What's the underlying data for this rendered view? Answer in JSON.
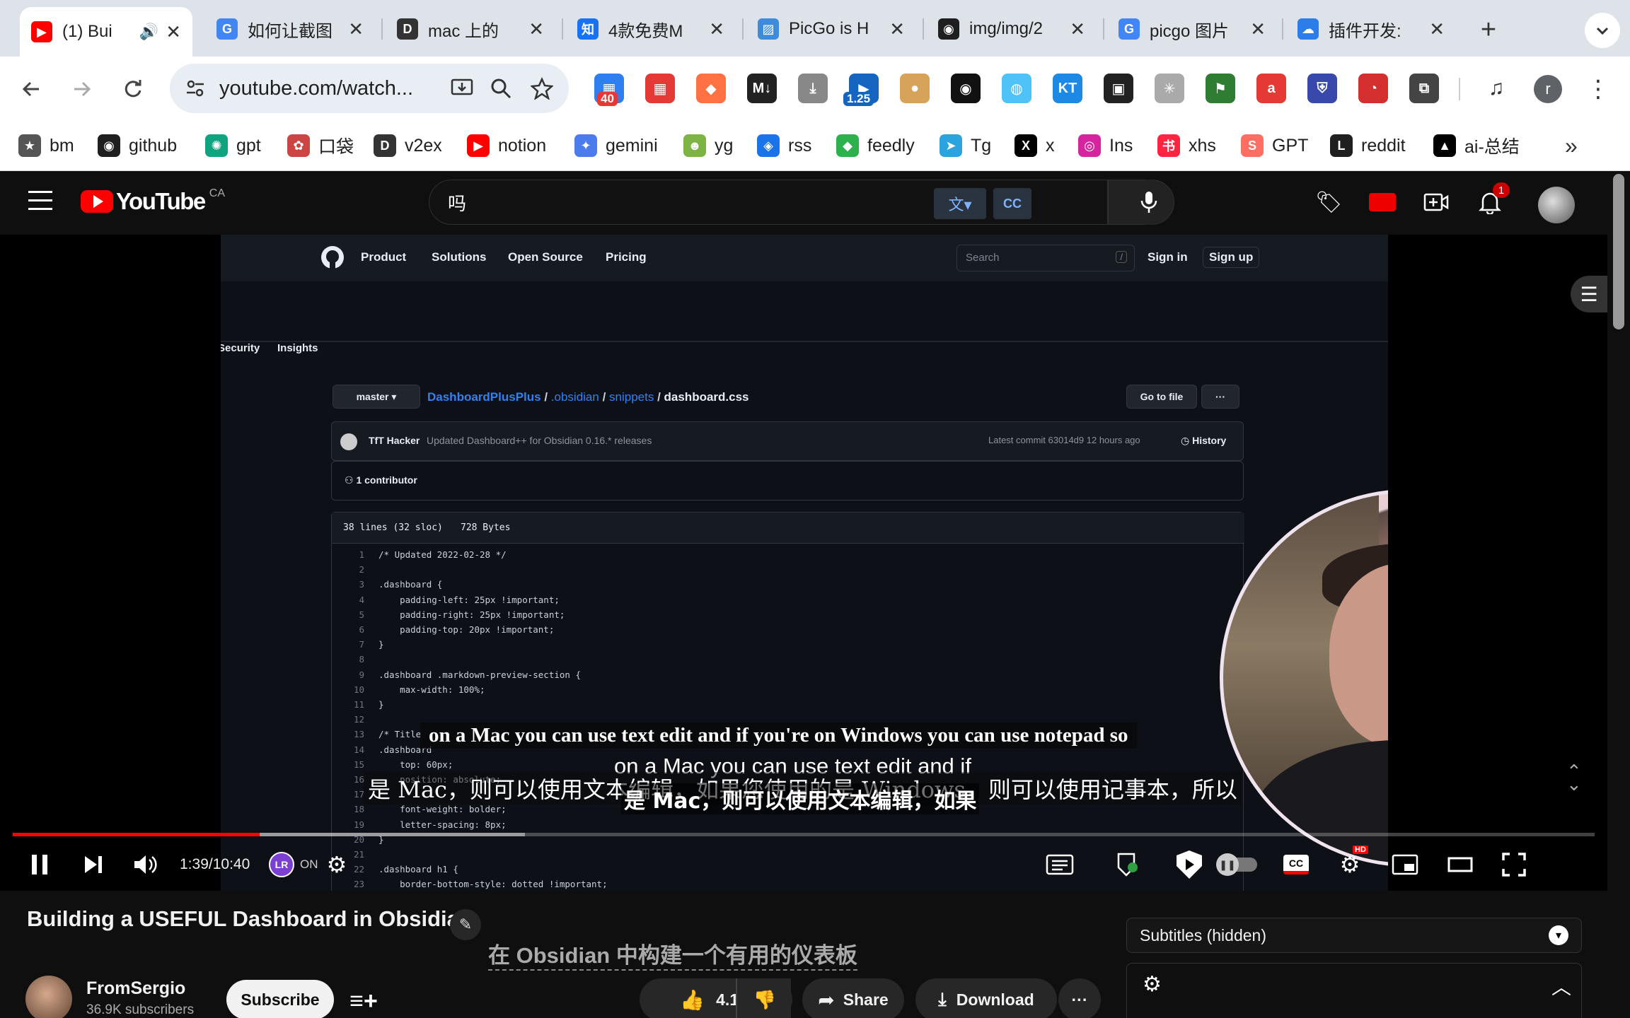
{
  "tabs": [
    {
      "title": "(1) Bui",
      "icon": "youtube",
      "color": "#ff0000",
      "glyph": "▶",
      "active": true
    },
    {
      "title": "如何让截图",
      "icon": "google",
      "color": "#4285f4",
      "glyph": "G"
    },
    {
      "title": "mac 上的",
      "icon": "v2ex",
      "color": "#333333",
      "glyph": "D"
    },
    {
      "title": "4款免费M",
      "icon": "zhihu",
      "color": "#1772f6",
      "glyph": "知"
    },
    {
      "title": "PicGo is H",
      "icon": "picgo",
      "color": "#3d8bd9",
      "glyph": "▨"
    },
    {
      "title": "img/img/2",
      "icon": "github",
      "color": "#1f1f1f",
      "glyph": "◉"
    },
    {
      "title": "picgo 图片",
      "icon": "google",
      "color": "#4285f4",
      "glyph": "G"
    },
    {
      "title": "插件开发:",
      "icon": "cloud",
      "color": "#2b7de9",
      "glyph": "☁"
    }
  ],
  "omnibox": {
    "url": "youtube.com/watch..."
  },
  "extension_badges": {
    "badge1": "40",
    "badge2": "1.25"
  },
  "bookmarks": [
    {
      "label": "bm",
      "glyph": "★",
      "color": "#555555"
    },
    {
      "label": "github",
      "glyph": "◉",
      "color": "#1f1f1f"
    },
    {
      "label": "gpt",
      "glyph": "✺",
      "color": "#10a37f"
    },
    {
      "label": "口袋",
      "glyph": "✿",
      "color": "#c44"
    },
    {
      "label": "v2ex",
      "glyph": "D",
      "color": "#333333"
    },
    {
      "label": "notion",
      "glyph": "▶",
      "color": "#ff0000"
    },
    {
      "label": "gemini",
      "glyph": "✦",
      "color": "#4b7bec"
    },
    {
      "label": "yg",
      "glyph": "☻",
      "color": "#7cb342"
    },
    {
      "label": "rss",
      "glyph": "◈",
      "color": "#1a73e8"
    },
    {
      "label": "feedly",
      "glyph": "◆",
      "color": "#2bb24c"
    },
    {
      "label": "Tg",
      "glyph": "➤",
      "color": "#2aa3df"
    },
    {
      "label": "x",
      "glyph": "X",
      "color": "#000000"
    },
    {
      "label": "Ins",
      "glyph": "◎",
      "color": "#d6249f"
    },
    {
      "label": "xhs",
      "glyph": "书",
      "color": "#ff2442"
    },
    {
      "label": "GPT",
      "glyph": "S",
      "color": "#ff6f61"
    },
    {
      "label": "reddit",
      "glyph": "L",
      "color": "#1f1f1f"
    },
    {
      "label": "ai-总结",
      "glyph": "▲",
      "color": "#000000"
    }
  ],
  "youtube": {
    "logo_text": "YouTube",
    "country": "CA",
    "search_value": "吗",
    "notification_count": "1"
  },
  "github_page": {
    "nav": [
      "Product",
      "Solutions",
      "Open Source",
      "Pricing"
    ],
    "search_placeholder": "Search",
    "search_key": "/",
    "sign_in": "Sign in",
    "sign_up": "Sign up",
    "tabs": [
      "Security",
      "Insights"
    ],
    "branch": "master",
    "path": {
      "repo": "DashboardPlusPlus",
      "sep1": " / ",
      "dir1": ".obsidian",
      "sep2": " / ",
      "dir2": "snippets",
      "sep3": " / ",
      "file": "dashboard.css"
    },
    "go_to_file": "Go to file",
    "more": "···",
    "commit_author": "TfT Hacker",
    "commit_message": "Updated Dashboard++ for Obsidian 0.16.* releases",
    "commit_meta": "Latest commit 63014d9 12 hours ago",
    "history": "History",
    "contributors": "1 contributor",
    "file_lines": "38 lines (32 sloc)",
    "file_size": "728 Bytes",
    "code": [
      {
        "n": "1",
        "t": "/* Updated 2022-02-28 */"
      },
      {
        "n": "2",
        "t": ""
      },
      {
        "n": "3",
        "t": ".dashboard {"
      },
      {
        "n": "4",
        "t": "    padding-left: 25px !important;"
      },
      {
        "n": "5",
        "t": "    padding-right: 25px !important;"
      },
      {
        "n": "6",
        "t": "    padding-top: 20px !important;"
      },
      {
        "n": "7",
        "t": "}"
      },
      {
        "n": "8",
        "t": ""
      },
      {
        "n": "9",
        "t": ".dashboard .markdown-preview-section {"
      },
      {
        "n": "10",
        "t": "    max-width: 100%;"
      },
      {
        "n": "11",
        "t": "}"
      },
      {
        "n": "12",
        "t": ""
      },
      {
        "n": "13",
        "t": "/* Title"
      },
      {
        "n": "14",
        "t": ".dashboard"
      },
      {
        "n": "15",
        "t": "    top: 60px;"
      },
      {
        "n": "16",
        "t": "    position: absolute;"
      },
      {
        "n": "17",
        "t": ""
      },
      {
        "n": "18",
        "t": "    font-weight: bolder;"
      },
      {
        "n": "19",
        "t": "    letter-spacing: 8px;"
      },
      {
        "n": "20",
        "t": "}"
      },
      {
        "n": "21",
        "t": ""
      },
      {
        "n": "22",
        "t": ".dashboard h1 {"
      },
      {
        "n": "23",
        "t": "    border-bottom-style: dotted !important;"
      }
    ]
  },
  "subtitles": {
    "en_burned": "on a Mac you can use text edit and if you're on Windows you can use notepad so",
    "en_overlay": "on a Mac you can use text edit and if",
    "zh_burned": "是 Mac，则可以使用文本编辑，如果您使用的是 Windows，则可以使用记事本，所以",
    "zh_overlay": "是 Mac，则可以使用文本编辑，如果"
  },
  "player": {
    "progress": 0.156,
    "current_time": "1:39",
    "separator": " / ",
    "duration": "10:40",
    "ext_status": "ON"
  },
  "video": {
    "title": "Building a USEFUL Dashboard in Obsidian",
    "title_translated": "在 Obsidian 中构建一个有用的仪表板",
    "channel": "FromSergio",
    "subscribers": "36.9K subscribers",
    "subscribe_label": "Subscribe",
    "likes": "4.1K",
    "share_label": "Share",
    "download_label": "Download",
    "subtitles_panel": "Subtitles (hidden)"
  }
}
